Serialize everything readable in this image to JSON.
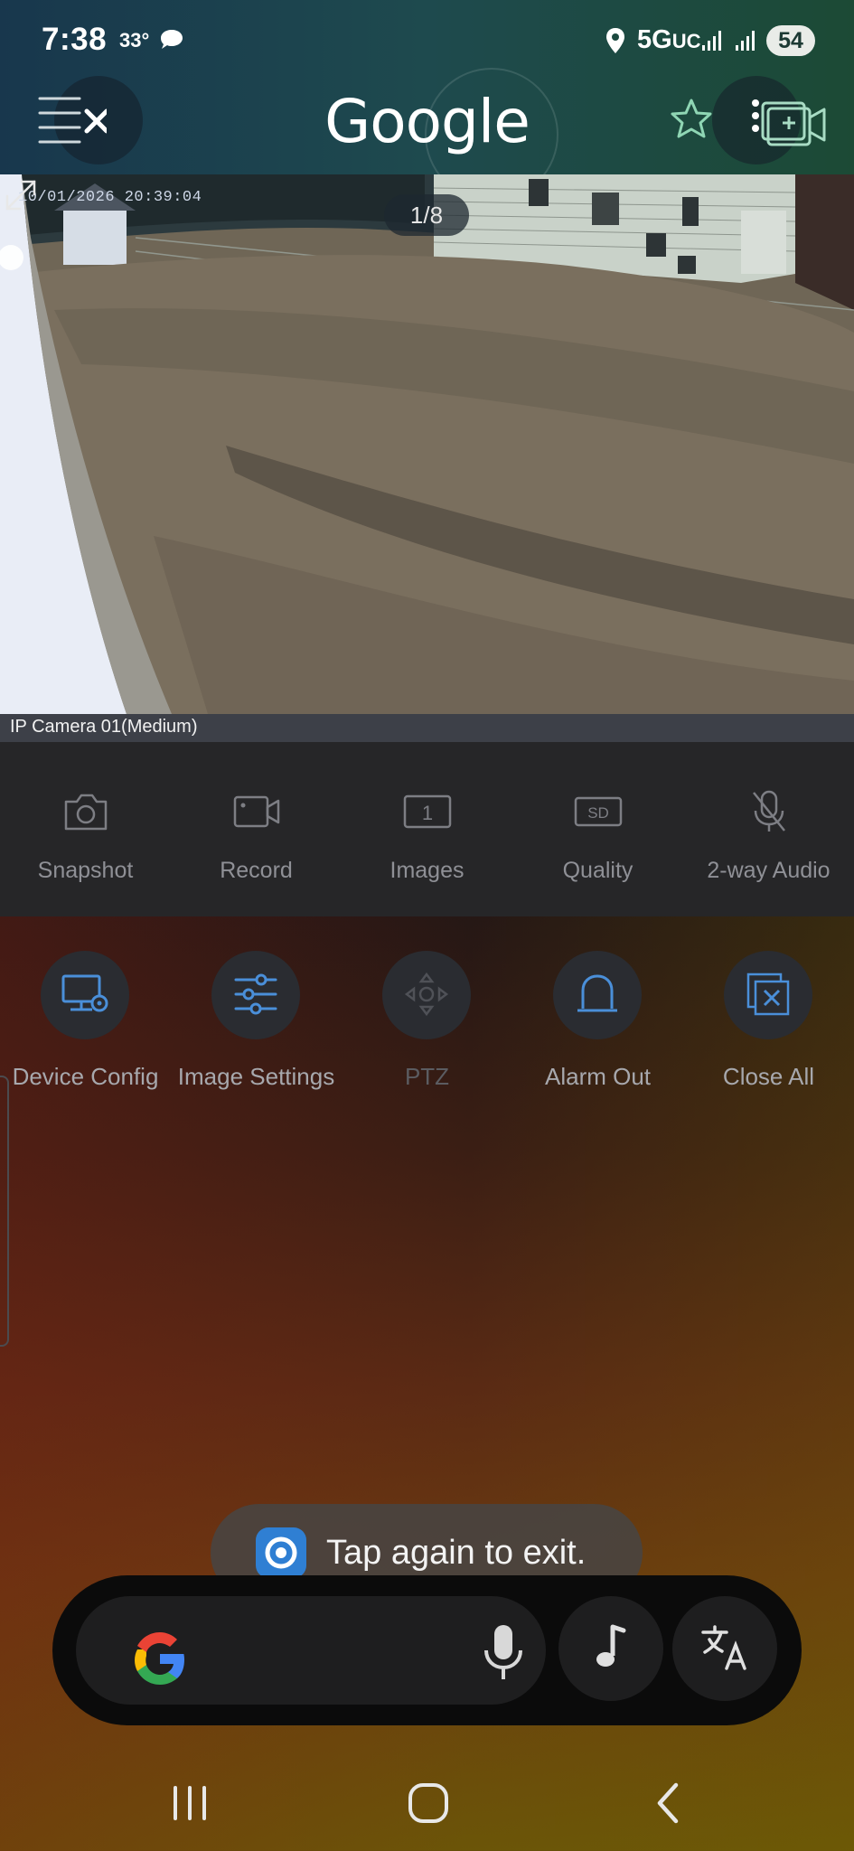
{
  "status_bar": {
    "time": "7:38",
    "temperature": "33°",
    "network": "5G",
    "network_suffix": "UC",
    "battery": "54",
    "icons": [
      "chat-bubble-icon",
      "location-pin-icon",
      "signal-icon",
      "signal-icon"
    ]
  },
  "header": {
    "logo_text": "Google",
    "icons": [
      "menu-icon",
      "close-icon",
      "lens-icon",
      "star-icon",
      "more-vertical-icon",
      "add-camera-icon"
    ]
  },
  "camera": {
    "timestamp": "10/01/2026 20:39:04",
    "page_indicator": "1/8",
    "label": "IP Camera 01(Medium)"
  },
  "toolbar": [
    {
      "label": "Snapshot",
      "icon": "camera-icon"
    },
    {
      "label": "Record",
      "icon": "video-record-icon"
    },
    {
      "label": "Images",
      "icon": "images-icon",
      "badge": "1"
    },
    {
      "label": "Quality",
      "icon": "quality-icon",
      "badge": "SD"
    },
    {
      "label": "2-way Audio",
      "icon": "mic-off-icon"
    }
  ],
  "actions": [
    {
      "label": "Device Config",
      "icon": "device-config-icon"
    },
    {
      "label": "Image Settings",
      "icon": "sliders-icon"
    },
    {
      "label": "PTZ",
      "icon": "ptz-icon",
      "disabled": true
    },
    {
      "label": "Alarm Out",
      "icon": "alarm-icon"
    },
    {
      "label": "Close All",
      "icon": "close-all-icon"
    }
  ],
  "toast": {
    "text": "Tap again to exit."
  },
  "search_bar": {
    "icons": [
      "google-g-icon",
      "mic-icon",
      "music-note-icon",
      "translate-icon"
    ]
  },
  "nav": {
    "icons": [
      "recents-icon",
      "home-icon",
      "back-icon"
    ]
  },
  "colors": {
    "accent_blue": "#4a8fd9",
    "toolbar_bg": "#262628",
    "top_band": "#1e4a4e"
  }
}
